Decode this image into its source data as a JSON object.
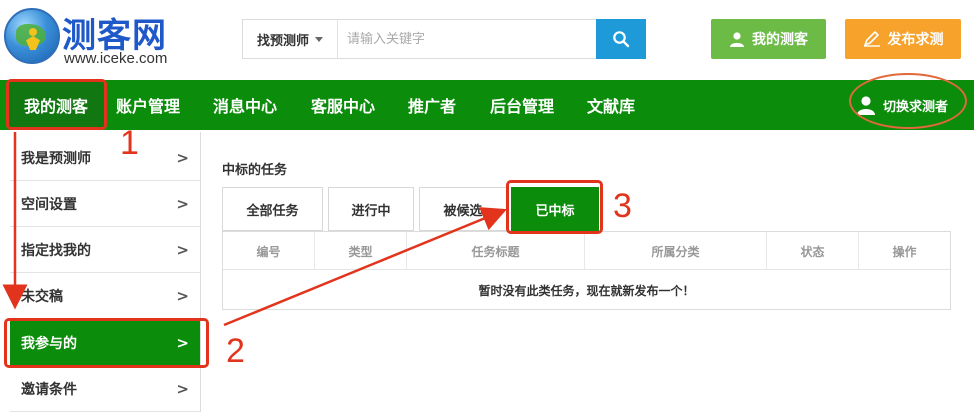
{
  "header": {
    "logo_title": "测客网",
    "logo_url": "www.iceke.com",
    "search": {
      "category": "找预测师",
      "placeholder": "请输入关键字"
    },
    "my_ceke_button": "我的测客",
    "post_request_button": "发布求测"
  },
  "nav": {
    "items": [
      "我的测客",
      "账户管理",
      "消息中心",
      "客服中心",
      "推广者",
      "后台管理",
      "文献库"
    ],
    "switch_label": "切换求测者"
  },
  "sidebar": {
    "items": [
      "我是预测师",
      "空间设置",
      "指定找我的",
      "未交稿",
      "我参与的",
      "邀请条件"
    ],
    "chevron": ">"
  },
  "main": {
    "title": "中标的任务",
    "tabs": [
      "全部任务",
      "进行中",
      "被候选",
      "已中标"
    ],
    "table_headers": [
      "编号",
      "类型",
      "任务标题",
      "所属分类",
      "状态",
      "操作"
    ],
    "empty_text": "暂时没有此类任务，现在就新发布一个！"
  },
  "annotations": {
    "step1": "1",
    "step2": "2",
    "step3": "3"
  },
  "colors": {
    "nav_green": "#0b8c0b",
    "search_blue": "#1e9ad8",
    "my_ceke_green": "#6cbb46",
    "post_orange": "#f6a22b",
    "annotation_red": "#e2341d"
  }
}
